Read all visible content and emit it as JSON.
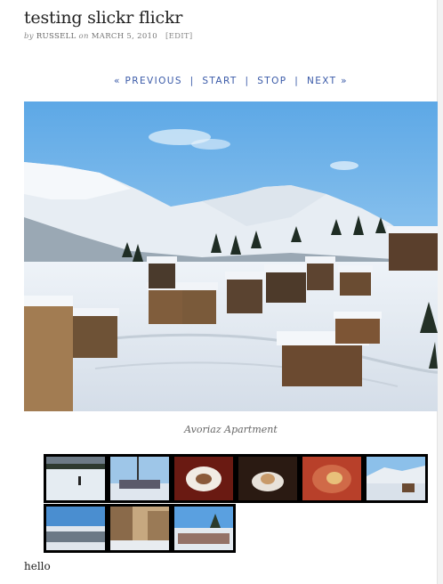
{
  "post": {
    "title": "testing slickr flickr",
    "meta_by": "by",
    "author": "RUSSELL",
    "meta_on": "on",
    "date": "MARCH 5, 2010",
    "edit_label": "[EDIT]"
  },
  "slideshow_nav": {
    "previous": "« PREVIOUS",
    "start": "START",
    "stop": "STOP",
    "next": "NEXT »",
    "separator": "|"
  },
  "photo": {
    "caption": "Avoriaz Apartment"
  },
  "thumbnails": [
    {
      "name": "thumb-snow-skier"
    },
    {
      "name": "thumb-ski-lift"
    },
    {
      "name": "thumb-dessert-plate"
    },
    {
      "name": "thumb-dessert-dark"
    },
    {
      "name": "thumb-dinner-plate"
    },
    {
      "name": "thumb-snow-village"
    },
    {
      "name": "thumb-ski-crowd"
    },
    {
      "name": "thumb-town-street"
    },
    {
      "name": "thumb-ski-slope-people"
    }
  ],
  "body_text": "hello"
}
